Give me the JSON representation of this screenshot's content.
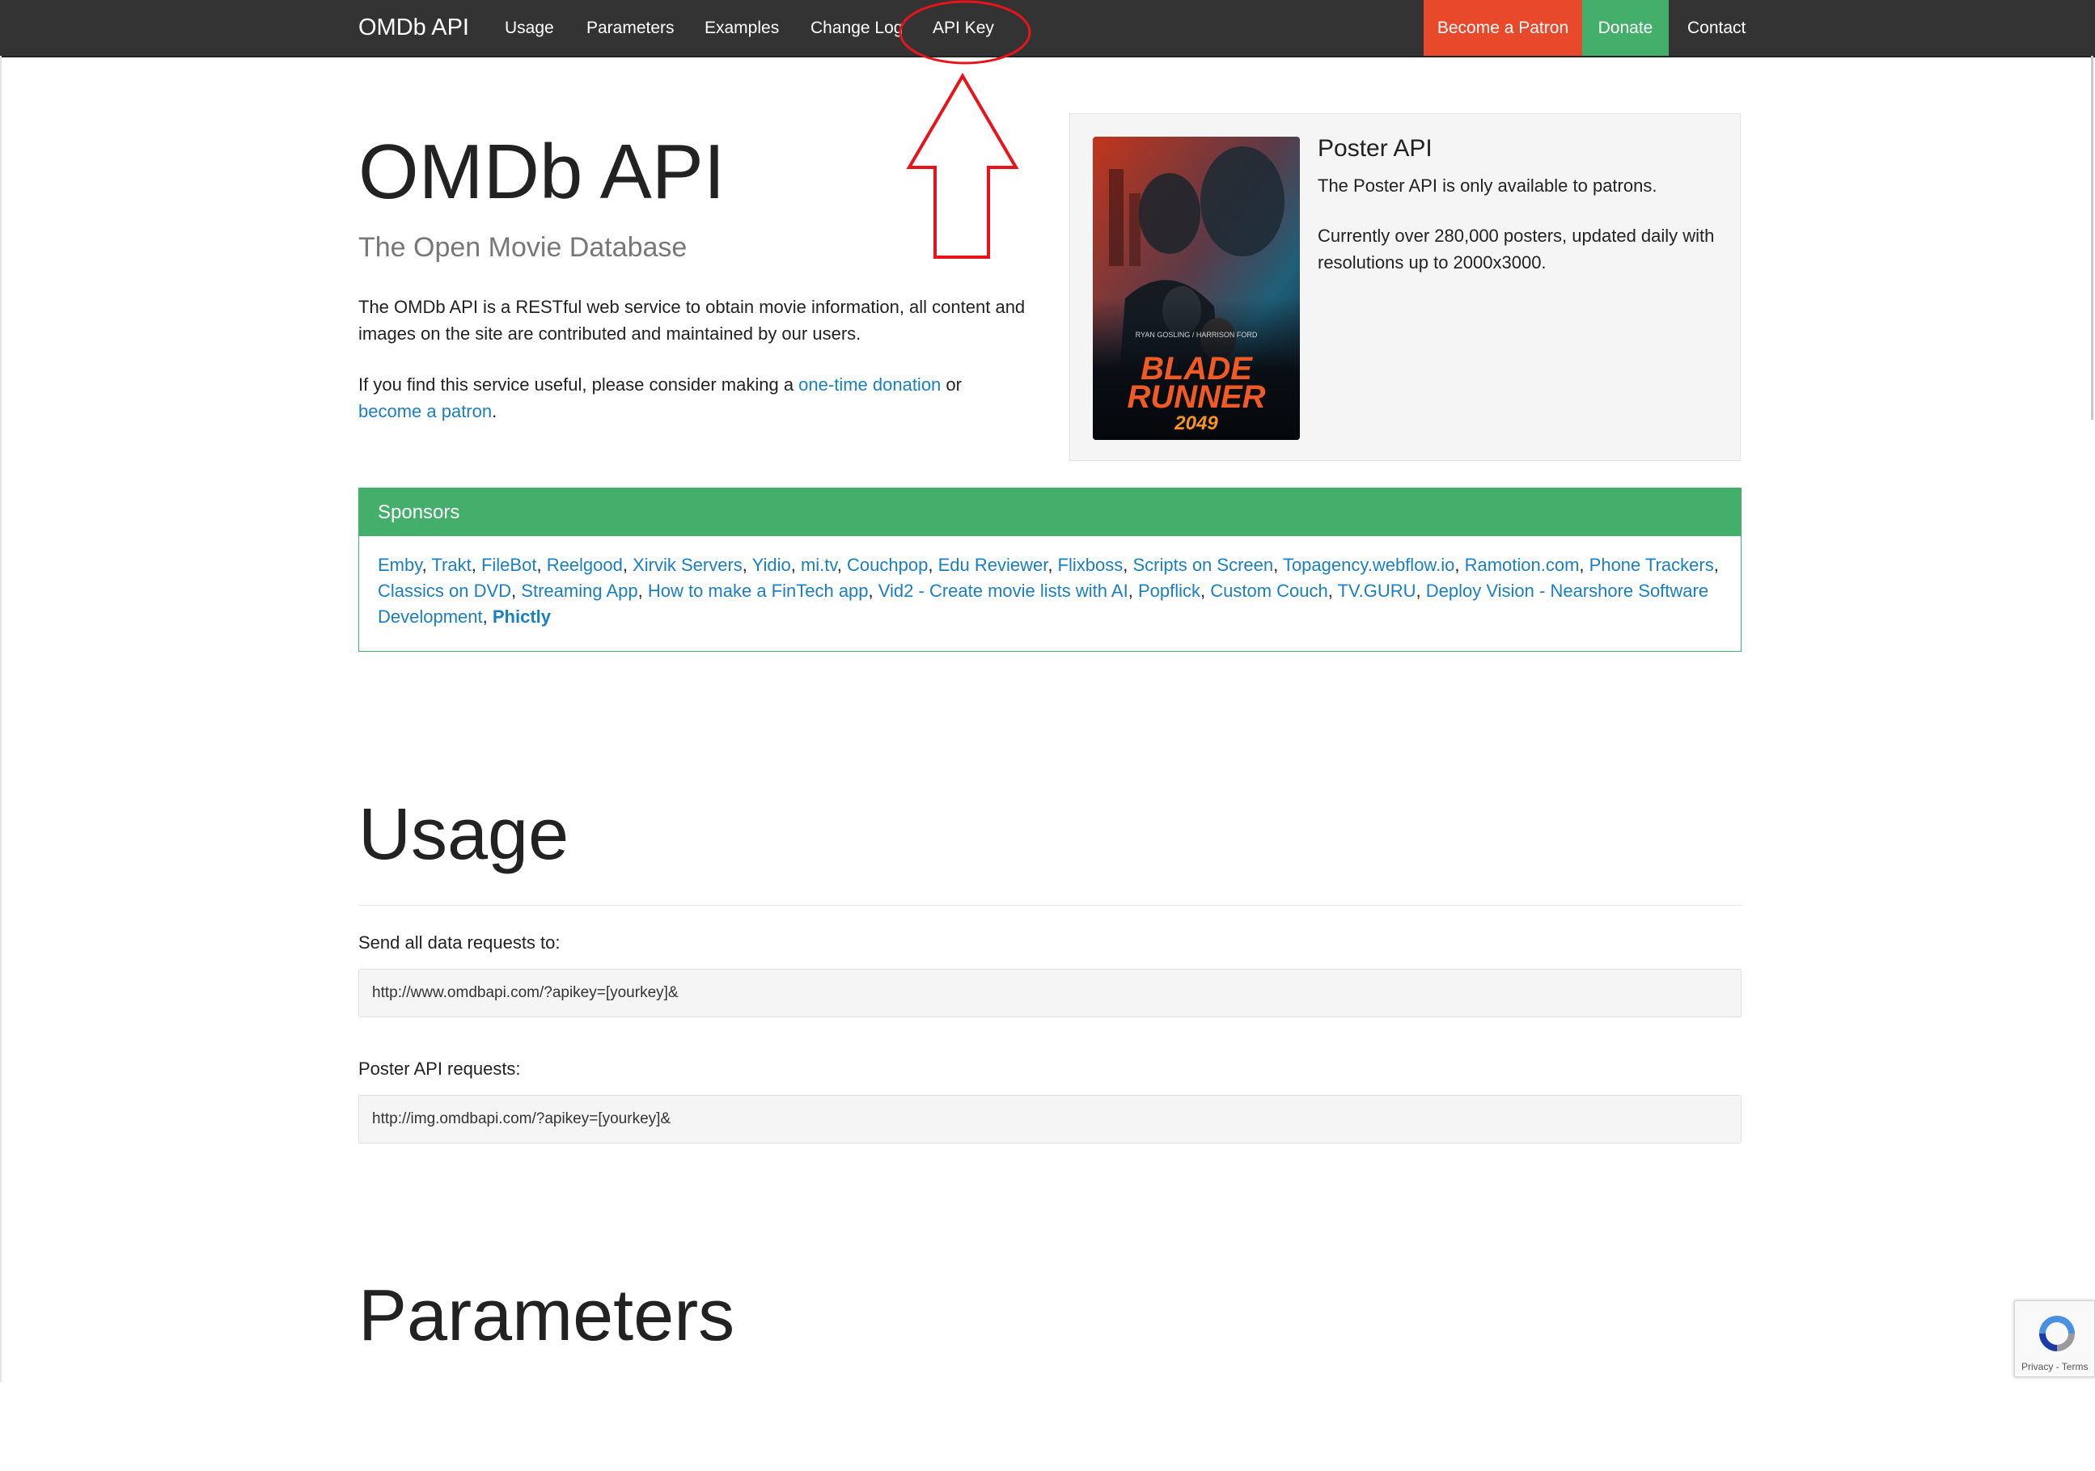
{
  "nav": {
    "brand": "OMDb API",
    "items": [
      "Usage",
      "Parameters",
      "Examples",
      "Change Log",
      "API Key"
    ],
    "patron": "Become a Patron",
    "donate": "Donate",
    "contact": "Contact",
    "colors": {
      "bar": "#333333",
      "patron": "#e8492b",
      "donate": "#44ae6b"
    }
  },
  "hero": {
    "title": "OMDb API",
    "subtitle": "The Open Movie Database",
    "desc": "The OMDb API is a RESTful web service to obtain movie information, all content and images on the site are contributed and maintained by our users.",
    "donate_pre": "If you find this service useful, please consider making a ",
    "donate_link": "one-time donation",
    "donate_mid": " or",
    "patron_link": "become a patron",
    "donate_end": "."
  },
  "poster": {
    "title": "Poster API",
    "line1": "The Poster API is only available to patrons.",
    "line2": "Currently over 280,000 posters, updated daily with resolutions up to 2000x3000.",
    "image_text": {
      "top": "RYAN GOSLING / HARRISON FORD",
      "title1": "BLADE",
      "title2": "RUNNER",
      "year": "2049"
    }
  },
  "sponsors": {
    "heading": "Sponsors",
    "links": [
      "Emby",
      "Trakt",
      "FileBot",
      "Reelgood",
      "Xirvik Servers",
      "Yidio",
      "mi.tv",
      "Couchpop",
      "Edu Reviewer",
      "Flixboss",
      "Scripts on Screen",
      "Topagency.webflow.io",
      "Ramotion.com",
      "Phone Trackers",
      "Classics on DVD",
      "Streaming App",
      "How to make a FinTech app",
      "Vid2 - Create movie lists with AI",
      "Popflick",
      "Custom Couch",
      "TV.GURU",
      "Deploy Vision - Nearshore Software Development"
    ],
    "bold_link": "Phictly"
  },
  "usage": {
    "title": "Usage",
    "label1": "Send all data requests to:",
    "url1": "http://www.omdbapi.com/?apikey=[yourkey]&",
    "label2": "Poster API requests:",
    "url2": "http://img.omdbapi.com/?apikey=[yourkey]&"
  },
  "parameters": {
    "title": "Parameters"
  },
  "recaptcha": {
    "links": "Privacy - Terms"
  },
  "annotation": {
    "color": "#e8141c"
  }
}
